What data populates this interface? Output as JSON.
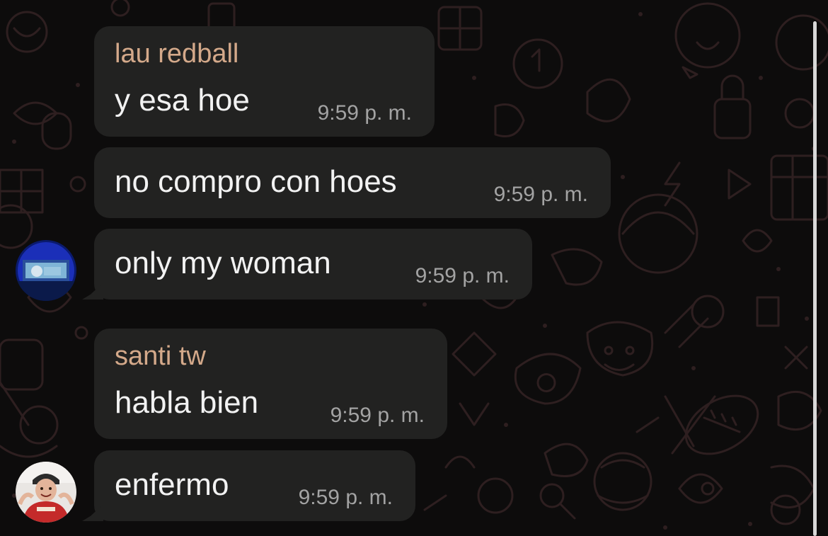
{
  "colors": {
    "background": "#0d0c0c",
    "bubble": "#222221",
    "message_text": "#f2f2f2",
    "sender_name": "#d4a98a",
    "timestamp": "#a3a3a3"
  },
  "messages": [
    {
      "sender": "lau redball",
      "text": "y esa hoe",
      "time": "9:59 p. m."
    },
    {
      "text": "no compro con hoes",
      "time": "9:59 p. m."
    },
    {
      "text": "only my woman",
      "time": "9:59 p. m."
    },
    {
      "sender": "santi tw",
      "text": "habla bien",
      "time": "9:59 p. m."
    },
    {
      "text": "enfermo",
      "time": "9:59 p. m."
    }
  ],
  "avatars": {
    "first": "user-avatar-photo",
    "second": "user-avatar-photo"
  }
}
